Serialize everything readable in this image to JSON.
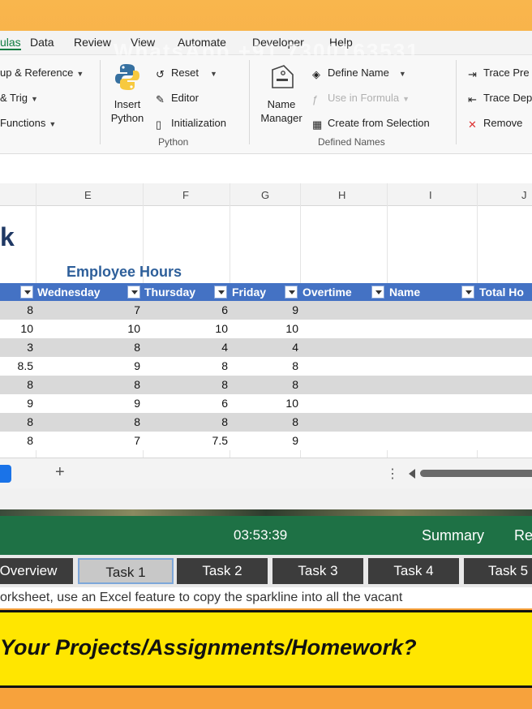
{
  "menu": {
    "items": [
      {
        "label": "ulas",
        "active": true
      },
      {
        "label": "Data"
      },
      {
        "label": "Review"
      },
      {
        "label": "View"
      },
      {
        "label": "Automate"
      },
      {
        "label": "Developer"
      },
      {
        "label": "Help"
      }
    ],
    "watermark": "WhatsApp +91 7300163531"
  },
  "ribbon": {
    "lookup": "up & Reference",
    "math": "& Trig",
    "functions": "Functions",
    "insert_python_line1": "Insert",
    "insert_python_line2": "Python",
    "reset": "Reset",
    "editor": "Editor",
    "initialization": "Initialization",
    "python_group": "Python",
    "name_manager_line1": "Name",
    "name_manager_line2": "Manager",
    "define_name": "Define Name",
    "use_in_formula": "Use in Formula",
    "create_from_selection": "Create from Selection",
    "defined_names_group": "Defined Names",
    "trace_precedents": "Trace Pre",
    "trace_dependents": "Trace Dep",
    "remove_arrows": "Remove"
  },
  "grid": {
    "columns": [
      "E",
      "F",
      "G",
      "H",
      "I",
      "J"
    ],
    "big_text": "k",
    "title": "Employee Hours",
    "headers": [
      "Wednesday",
      "Thursday",
      "Friday",
      "Overtime",
      "Name",
      "Total Ho"
    ],
    "rows": [
      [
        "8",
        "7",
        "6",
        "9"
      ],
      [
        "10",
        "10",
        "10",
        "10"
      ],
      [
        "3",
        "8",
        "4",
        "4"
      ],
      [
        "8.5",
        "9",
        "8",
        "8"
      ],
      [
        "8",
        "8",
        "8",
        "8"
      ],
      [
        "9",
        "9",
        "6",
        "10"
      ],
      [
        "8",
        "8",
        "8",
        "8"
      ],
      [
        "8",
        "7",
        "7.5",
        "9"
      ]
    ]
  },
  "sheetbar": {
    "add": "+",
    "more": "⋮"
  },
  "exam": {
    "timer": "03:53:39",
    "summary": "Summary",
    "re": "Re",
    "tasks": [
      "Overview",
      "Task 1",
      "Task 2",
      "Task 3",
      "Task 4",
      "Task 5"
    ],
    "selected_task": "Task 1",
    "instruction": "orksheet, use an Excel feature to copy the sparkline into all the vacant"
  },
  "banner": {
    "text": "Your Projects/Assignments/Homework?"
  },
  "colors": {
    "accent": "#107c41",
    "table_header": "#4472c4",
    "exam_bar": "#1e7145",
    "banner": "#ffe600"
  }
}
